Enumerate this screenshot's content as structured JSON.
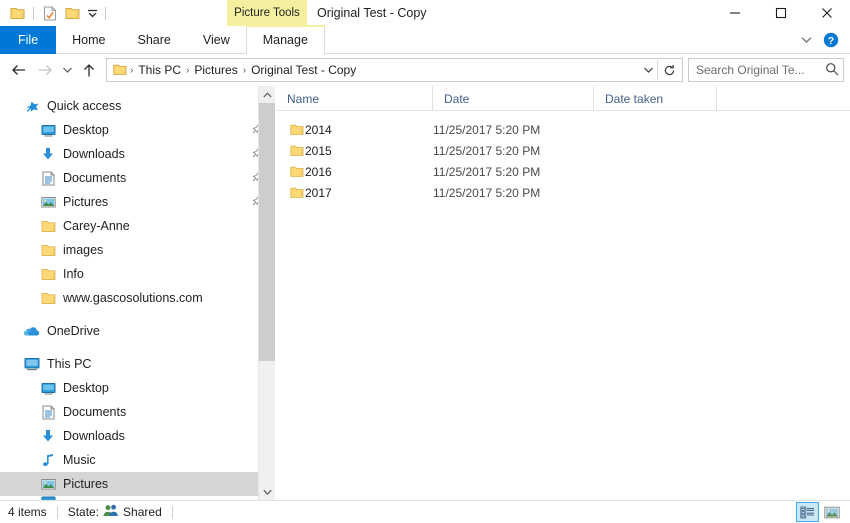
{
  "window": {
    "title": "Original Test - Copy",
    "contextual_tab_group": "Picture Tools",
    "controls": {
      "minimize": "minimize-button",
      "maximize": "maximize-button",
      "close": "close-button"
    }
  },
  "quick_access_toolbar": {
    "items": [
      {
        "icon": "folder-icon",
        "name": "properties-button"
      },
      {
        "icon": "checked-document-icon",
        "name": "new-folder-button"
      },
      {
        "icon": "folder-icon",
        "name": "folder-button"
      }
    ],
    "customize_label": "▾"
  },
  "ribbon": {
    "tabs": [
      {
        "label": "File",
        "active": false,
        "style": "file"
      },
      {
        "label": "Home",
        "active": false,
        "style": "normal"
      },
      {
        "label": "Share",
        "active": false,
        "style": "normal"
      },
      {
        "label": "View",
        "active": false,
        "style": "normal"
      },
      {
        "label": "Manage",
        "active": true,
        "style": "contextual"
      }
    ],
    "collapse_glyph": "⌄",
    "help_label": "?"
  },
  "address_bar": {
    "back_label": "←",
    "forward_label": "→",
    "recent_label": "⌄",
    "up_label": "↑",
    "breadcrumbs": [
      "This PC",
      "Pictures",
      "Original Test - Copy"
    ],
    "separator": "›",
    "dropdown_glyph": "⌄",
    "refresh_glyph": "↻"
  },
  "search": {
    "placeholder": "Search Original Te...",
    "value": "Search Original Te...",
    "icon": "search-icon"
  },
  "sidebar": {
    "groups": [
      {
        "header": {
          "label": "Quick access",
          "icon": "quick-access-star-icon"
        },
        "items": [
          {
            "label": "Desktop",
            "icon": "desktop-icon",
            "pinned": true
          },
          {
            "label": "Downloads",
            "icon": "downloads-icon",
            "pinned": true
          },
          {
            "label": "Documents",
            "icon": "documents-icon",
            "pinned": true
          },
          {
            "label": "Pictures",
            "icon": "pictures-icon",
            "pinned": true
          },
          {
            "label": "Carey-Anne",
            "icon": "folder-icon",
            "pinned": false
          },
          {
            "label": "images",
            "icon": "folder-icon",
            "pinned": false
          },
          {
            "label": "Info",
            "icon": "folder-icon",
            "pinned": false
          },
          {
            "label": "www.gascosolutions.com",
            "icon": "folder-icon",
            "pinned": false
          }
        ]
      },
      {
        "header": {
          "label": "OneDrive",
          "icon": "onedrive-cloud-icon"
        },
        "items": []
      },
      {
        "header": {
          "label": "This PC",
          "icon": "this-pc-icon"
        },
        "items": [
          {
            "label": "Desktop",
            "icon": "desktop-icon",
            "selected": false
          },
          {
            "label": "Documents",
            "icon": "documents-icon",
            "selected": false
          },
          {
            "label": "Downloads",
            "icon": "downloads-icon",
            "selected": false
          },
          {
            "label": "Music",
            "icon": "music-note-icon",
            "selected": false
          },
          {
            "label": "Pictures",
            "icon": "pictures-icon",
            "selected": true
          }
        ]
      }
    ],
    "scrollbar": {
      "up_glyph": "⌃",
      "down_glyph": "⌄"
    }
  },
  "file_list": {
    "columns": [
      {
        "label": "Name"
      },
      {
        "label": "Date"
      },
      {
        "label": "Date taken"
      },
      {
        "label": ""
      }
    ],
    "rows": [
      {
        "name": "2014",
        "date": "11/25/2017 5:20 PM",
        "date_taken": "",
        "icon": "folder-icon"
      },
      {
        "name": "2015",
        "date": "11/25/2017 5:20 PM",
        "date_taken": "",
        "icon": "folder-icon"
      },
      {
        "name": "2016",
        "date": "11/25/2017 5:20 PM",
        "date_taken": "",
        "icon": "folder-icon"
      },
      {
        "name": "2017",
        "date": "11/25/2017 5:20 PM",
        "date_taken": "",
        "icon": "folder-icon"
      }
    ]
  },
  "status_bar": {
    "item_count": "4 items",
    "state_label": "State:",
    "state_value": "Shared",
    "state_icon": "shared-people-icon",
    "views": [
      {
        "name": "details-view-button",
        "active": true
      },
      {
        "name": "large-icons-view-button",
        "active": false
      }
    ]
  },
  "colors": {
    "accent_blue": "#0078d7",
    "contextual_yellow": "#f5f0a0",
    "folder_yellow": "#fcd975",
    "selection_gray": "#d6d6d6",
    "header_text_blue": "#41618a"
  }
}
